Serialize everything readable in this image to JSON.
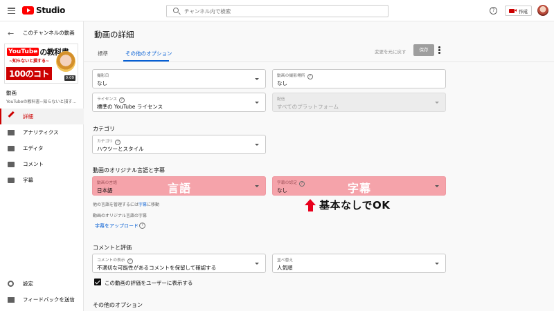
{
  "topbar": {
    "logo_text": "Studio",
    "search_placeholder": "チャンネル内で検索",
    "help_symbol": "?",
    "create_label": "作成"
  },
  "sidebar": {
    "back_label": "このチャンネルの動画",
    "thumbnail": {
      "brand": "YouTube",
      "headline": "の教科書",
      "tagline": "~知らないと損する~",
      "big_text": "100のコト",
      "duration": "0:09"
    },
    "video_title": "動画",
    "video_subtitle": "YouTubeの教科書~知らないと損す...",
    "nav": [
      {
        "label": "詳細",
        "active": true,
        "icon": "pencil-icon"
      },
      {
        "label": "アナリティクス",
        "active": false,
        "icon": "analytics-icon"
      },
      {
        "label": "エディタ",
        "active": false,
        "icon": "editor-icon"
      },
      {
        "label": "コメント",
        "active": false,
        "icon": "comment-icon"
      },
      {
        "label": "字幕",
        "active": false,
        "icon": "subtitles-icon"
      }
    ],
    "bottom_nav": [
      {
        "label": "設定",
        "icon": "gear-icon"
      },
      {
        "label": "フィードバックを送信",
        "icon": "feedback-icon"
      }
    ]
  },
  "main": {
    "title": "動画の詳細",
    "tabs": [
      {
        "label": "標準",
        "active": false
      },
      {
        "label": "その他のオプション",
        "active": true
      }
    ],
    "undo_label": "変更を元に戻す",
    "save_label": "保存",
    "recording_date": {
      "label": "撮影日",
      "value": "なし"
    },
    "recording_location": {
      "label": "動画の撮影場所",
      "value": "なし"
    },
    "license": {
      "label": "ライセンス",
      "value": "標準の YouTube ライセンス"
    },
    "distribution": {
      "label": "配信",
      "value": "すべてのプラットフォーム"
    },
    "category_heading": "カテゴリ",
    "category": {
      "label": "カテゴリ",
      "value": "ハウツーとスタイル"
    },
    "language_heading": "動画のオリジナル言語と字幕",
    "video_language": {
      "label": "動画の言語",
      "value": "日本語",
      "overlay": "言語"
    },
    "caption_cert": {
      "label": "字幕の認定",
      "value": "なし",
      "overlay": "字幕"
    },
    "manage_langs_prefix": "他の言語を管理するには",
    "manage_langs_link": "字幕",
    "manage_langs_suffix": "に移動",
    "original_lang_captions": "動画のオリジナル言語の字幕",
    "upload_captions": "字幕をアップロード",
    "annotation": "基本なしでOK",
    "comments_heading": "コメントと評価",
    "comment_visibility": {
      "label": "コメントの表示",
      "value": "不適切な可能性があるコメントを保留して確認する"
    },
    "sort_by": {
      "label": "並べ替え",
      "value": "人気順"
    },
    "show_ratings_label": "この動画の評価をユーザーに表示する",
    "show_ratings_checked": true,
    "more_options_heading": "その他のオプション"
  }
}
